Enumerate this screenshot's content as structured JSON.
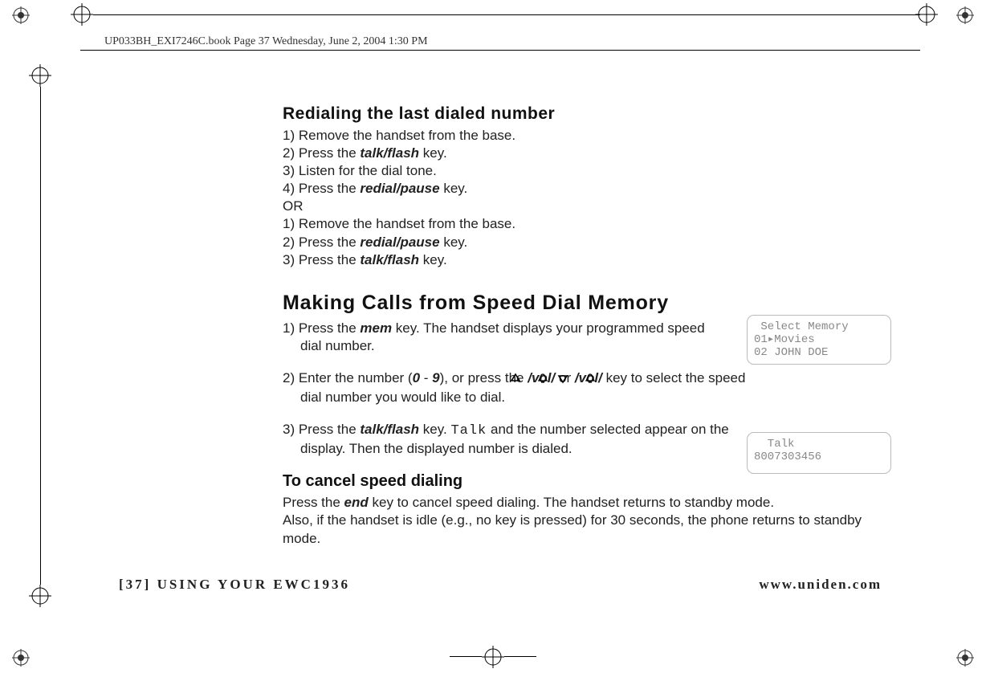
{
  "header": {
    "runner": "UP033BH_EXI7246C.book  Page 37  Wednesday, June 2, 2004  1:30 PM"
  },
  "section1": {
    "title": "Redialing the last dialed number",
    "steps_a": {
      "s1": "1) Remove the handset from the base.",
      "s2_pre": "2) Press the ",
      "s2_key": "talk/flash",
      "s2_post": " key.",
      "s3": "3) Listen for the dial tone.",
      "s4_pre": "4) Press the ",
      "s4_key": "redial/pause",
      "s4_post": " key."
    },
    "or": "OR",
    "steps_b": {
      "s1": "1) Remove the handset from the base.",
      "s2_pre": "2) Press the ",
      "s2_key": "redial/pause",
      "s2_post": " key.",
      "s3_pre": "3) Press the ",
      "s3_key": "talk/flash",
      "s3_post": " key."
    }
  },
  "section2": {
    "title": "Making Calls from Speed Dial Memory",
    "step1_pre": "1) Press the ",
    "step1_key": "mem",
    "step1_post": " key. The handset displays your programmed speed dial number.",
    "step2_pre": "2) Enter the number (",
    "step2_zero": "0",
    "step2_dash": " - ",
    "step2_nine": "9",
    "step2_mid1": "), or press the ",
    "step2_vol": "/vol/",
    "step2_or": " or ",
    "step2_post": " key to select the speed dial number you would like to dial.",
    "step3_pre": "3) Press the ",
    "step3_key": "talk/flash",
    "step3_mid": " key. ",
    "step3_talk": "Talk",
    "step3_post1": " and the number selected appear on the display. Then the displayed number is dialed."
  },
  "section3": {
    "title": "To cancel speed dialing",
    "body_pre": "Press the ",
    "body_key": "end",
    "body_mid": " key to cancel speed dialing. The handset returns to standby mode.",
    "body2": "Also, if the handset is idle (e.g., no key is pressed) for 30 seconds, the phone returns to standby mode."
  },
  "lcd1": {
    "l1": " Select Memory",
    "l2": "01▸Movies",
    "l3": "02 JOHN DOE"
  },
  "lcd2": {
    "l1": "  Talk",
    "l2": "8007303456"
  },
  "footer": {
    "left": "[37] USING YOUR EWC1936",
    "right": "www.uniden.com"
  }
}
